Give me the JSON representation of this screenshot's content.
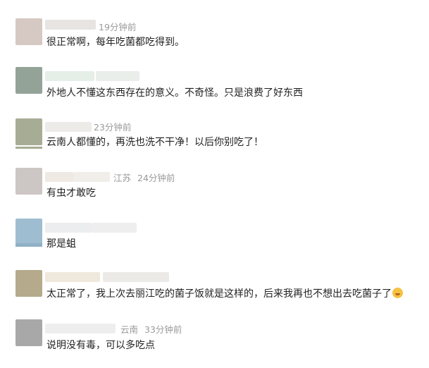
{
  "comments": [
    {
      "avatar_color": "#d6c8c2",
      "location": "",
      "time": "19分钟前",
      "text": "很正常啊，每年吃菌都吃得到。",
      "name_blur_colors": [
        "#e7e4e2",
        "#ecebea"
      ]
    },
    {
      "avatar_color": "#93a397",
      "location": "",
      "time": "",
      "text": "外地人不懂这东西存在的意义。不奇怪。只是浪费了好东西",
      "name_blur_colors": [
        "#e6efe7",
        "#e9eeea"
      ]
    },
    {
      "avatar_color": "#a7ad94",
      "location": "",
      "time": "23分钟前",
      "text": "云南人都懂的，再洗也洗不干净！以后你别吃了！",
      "name_blur_colors": [
        "#ecebe8"
      ]
    },
    {
      "avatar_color": "#ccc6c4",
      "location": "江苏",
      "time": "24分钟前",
      "text": "有虫才敢吃",
      "name_blur_colors": [
        "#efe9e3",
        "#f1ede9"
      ]
    },
    {
      "avatar_color": "#9fbdd0",
      "location": "",
      "time": "",
      "text": "那是蛆",
      "name_blur_colors": [
        "#ecedee",
        "#eeeeef"
      ]
    },
    {
      "avatar_color": "#b5ab8c",
      "location": "",
      "time": "",
      "text": "太正常了，我上次去丽江吃的菌子饭就是这样的，后来我再也不想出去吃菌子了",
      "emoji": "laugh-cry-emoji",
      "name_blur_colors": [
        "#efe8dc",
        "#ebeae6"
      ]
    },
    {
      "avatar_color": "#a9a8a8",
      "location": "云南",
      "time": "33分钟前",
      "text": "说明没有毒，可以多吃点",
      "name_blur_colors": [
        "#eeeeee"
      ]
    }
  ]
}
